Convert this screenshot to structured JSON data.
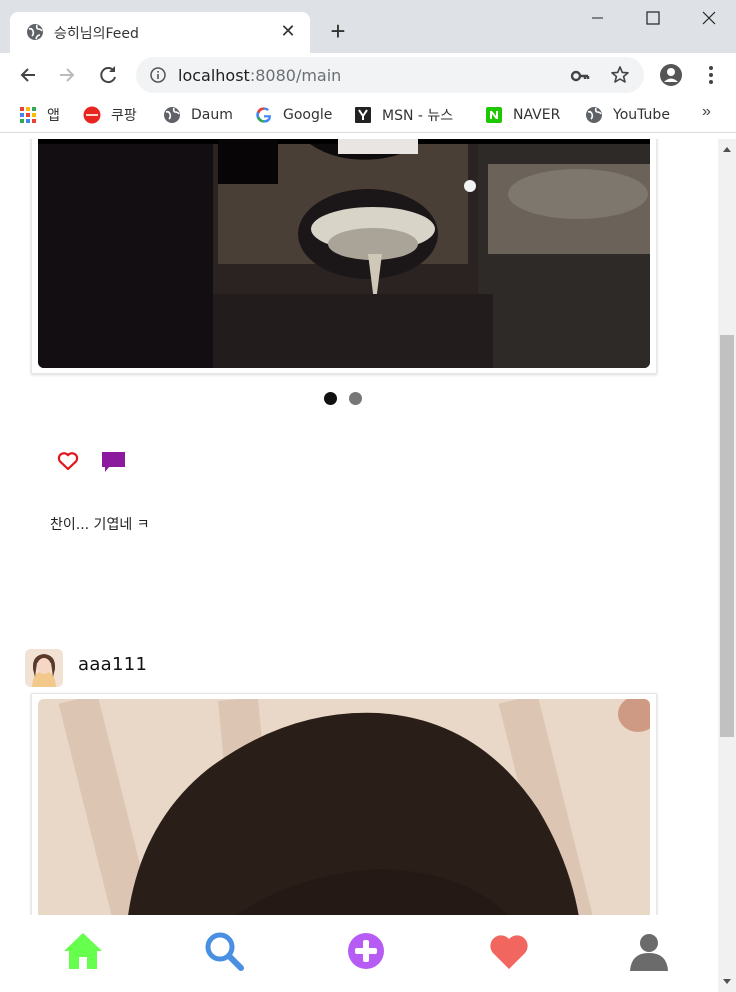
{
  "browser": {
    "tab_title": "승히님의Feed",
    "url_host": "localhost",
    "url_path": ":8080/main",
    "bookmarks": [
      "앱",
      "쿠팡",
      "Daum",
      "Google",
      "MSN - 뉴스",
      "NAVER",
      "YouTube"
    ],
    "bookmarks_more": "»"
  },
  "feed": {
    "post1": {
      "caption": "찬이... 기엽네 ㅋ",
      "slides_total": 2,
      "slide_active": 1
    },
    "post2": {
      "username": "aaa111"
    }
  },
  "colors": {
    "home": "#66ff4d",
    "search": "#4a90e2",
    "add": "#b65cf5",
    "likes": "#f26660",
    "profile": "#6b6b6b",
    "heart_outline": "#e0161d",
    "comment": "#8b1a9e"
  },
  "icons": {
    "nav": [
      "home-icon",
      "search-icon",
      "add-icon",
      "heart-icon",
      "profile-icon"
    ]
  }
}
